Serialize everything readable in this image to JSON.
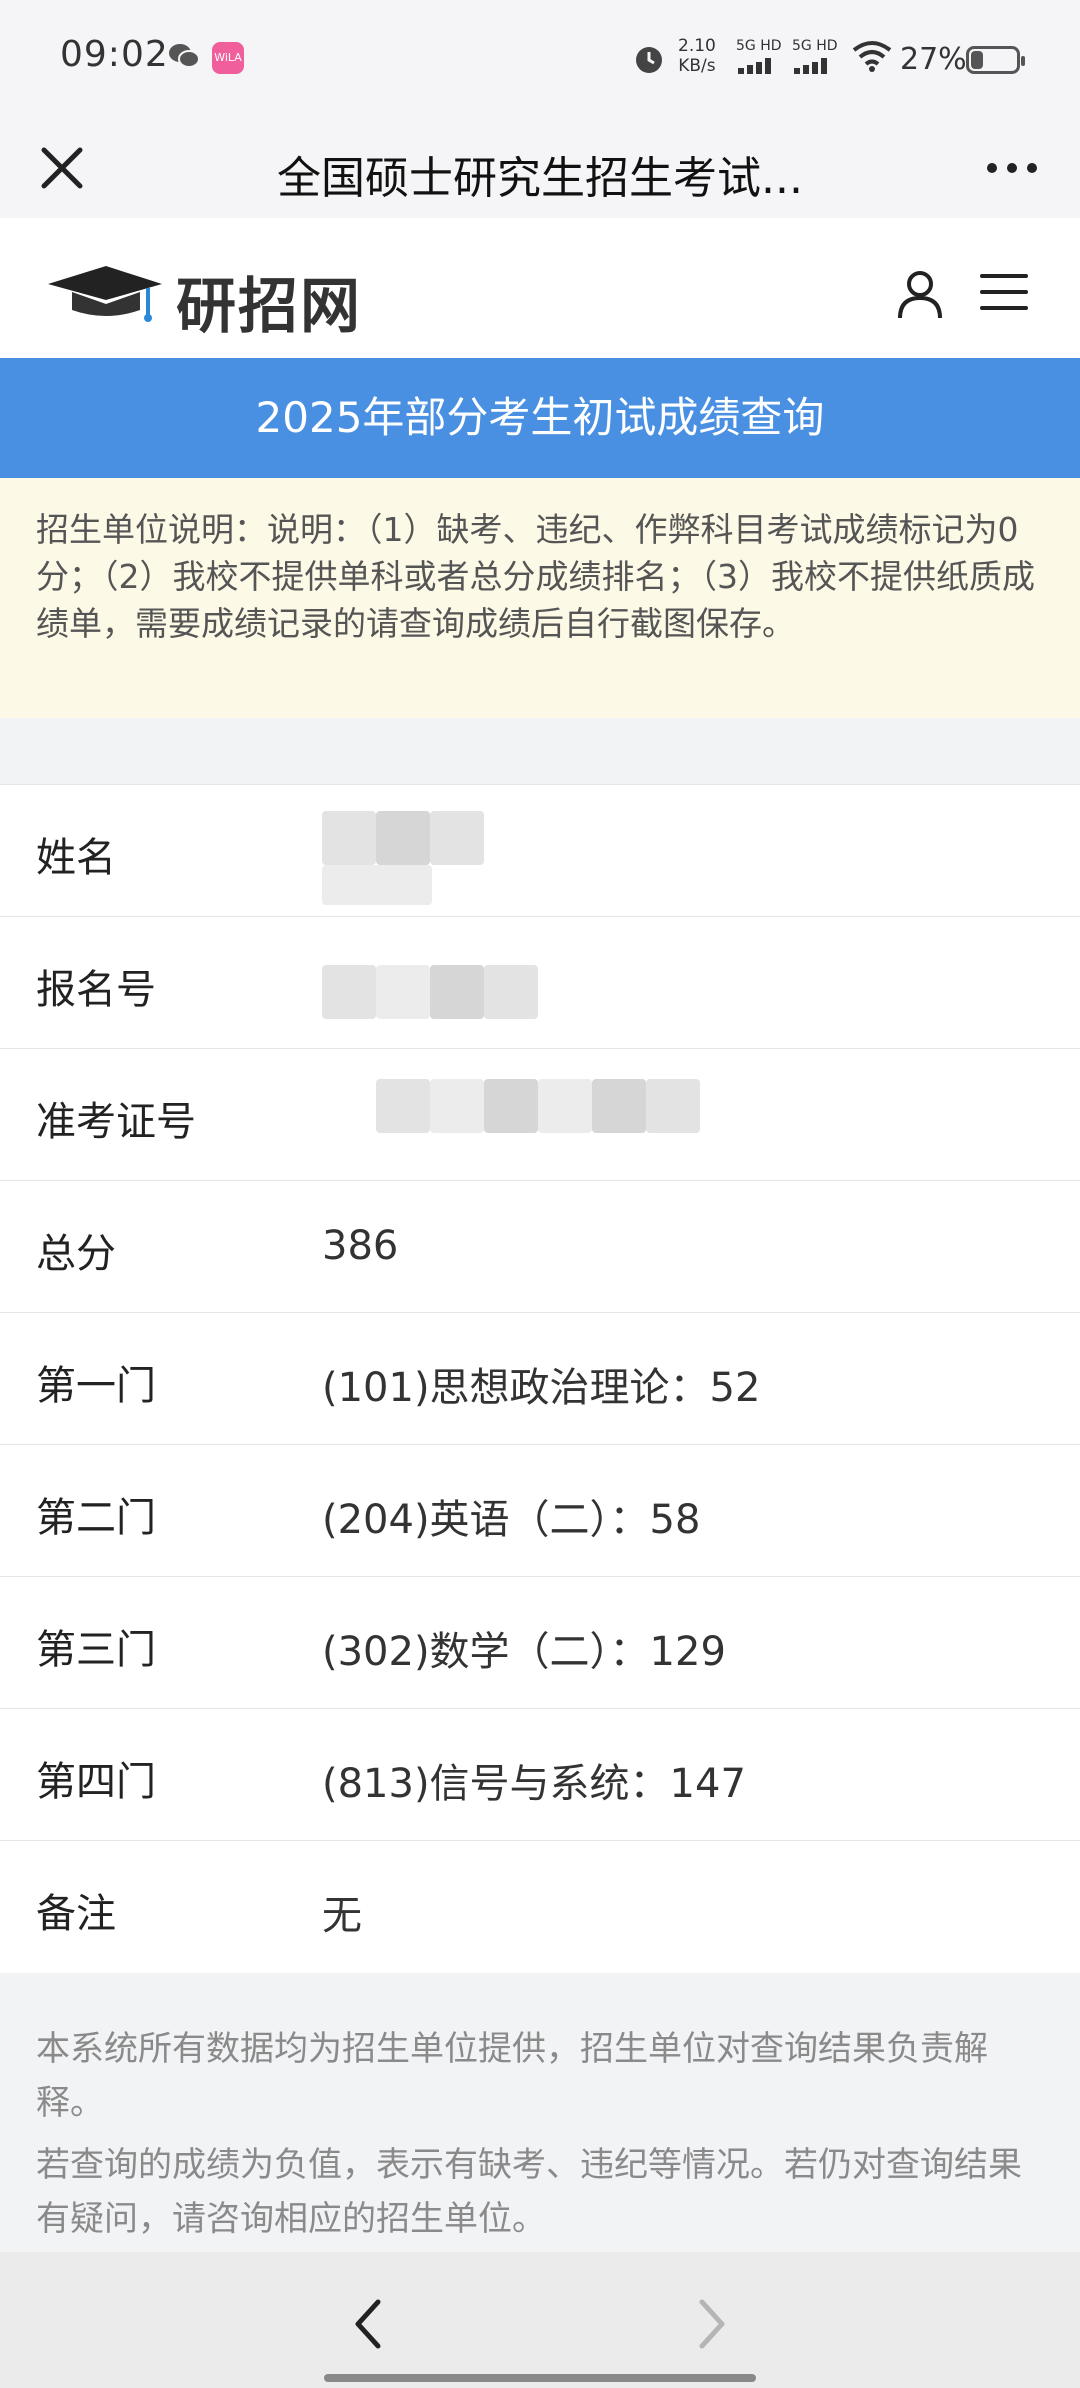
{
  "status_bar": {
    "time": "09:02",
    "net_speed_value": "2.10",
    "net_speed_unit": "KB/s",
    "sim1_label": "5G HD",
    "sim2_label": "5G HD",
    "battery_text": "27%",
    "battery_level": 0.27,
    "app_badge_text": "WiLA",
    "icons": [
      "wechat-icon",
      "app-badge-icon",
      "alarm-icon",
      "signal-icon",
      "wifi-icon",
      "battery-icon"
    ]
  },
  "title_bar": {
    "title": "全国硕士研究生招生考试...",
    "close_icon": "close-icon",
    "more_icon": "more-icon"
  },
  "site_header": {
    "logo_text": "研招网",
    "icons": [
      "graduation-cap-icon",
      "user-icon",
      "menu-icon"
    ]
  },
  "banner": {
    "title": "2025年部分考生初试成绩查询"
  },
  "notice": {
    "text": "招生单位说明：说明：（1）缺考、违纪、作弊科目考试成绩标记为0分；（2）我校不提供单科或者总分成绩排名；（3）我校不提供纸质成绩单，需要成绩记录的请查询成绩后自行截图保存。"
  },
  "records": [
    {
      "label": "姓名",
      "value": ""
    },
    {
      "label": "报名号",
      "value": ""
    },
    {
      "label": "准考证号",
      "value": ""
    },
    {
      "label": "总分",
      "value": "386"
    },
    {
      "label": "第一门",
      "value": "(101)思想政治理论：52"
    },
    {
      "label": "第二门",
      "value": "(204)英语（二）：58"
    },
    {
      "label": "第三门",
      "value": "(302)数学（二）：129"
    },
    {
      "label": "第四门",
      "value": "(813)信号与系统：147"
    },
    {
      "label": "备注",
      "value": "无"
    }
  ],
  "footnote": {
    "line1": "本系统所有数据均为招生单位提供，招生单位对查询结果负责解释。",
    "line2": "若查询的成绩为负值，表示有缺考、违纪等情况。若仍对查询结果有疑问，请咨询相应的招生单位。"
  },
  "nav_bar": {
    "icons": [
      "back-arrow-icon",
      "forward-arrow-icon"
    ]
  },
  "colors": {
    "banner_bg": "#4a90e2",
    "notice_bg": "#fdf9e7",
    "page_bg": "#f2f3f5"
  }
}
